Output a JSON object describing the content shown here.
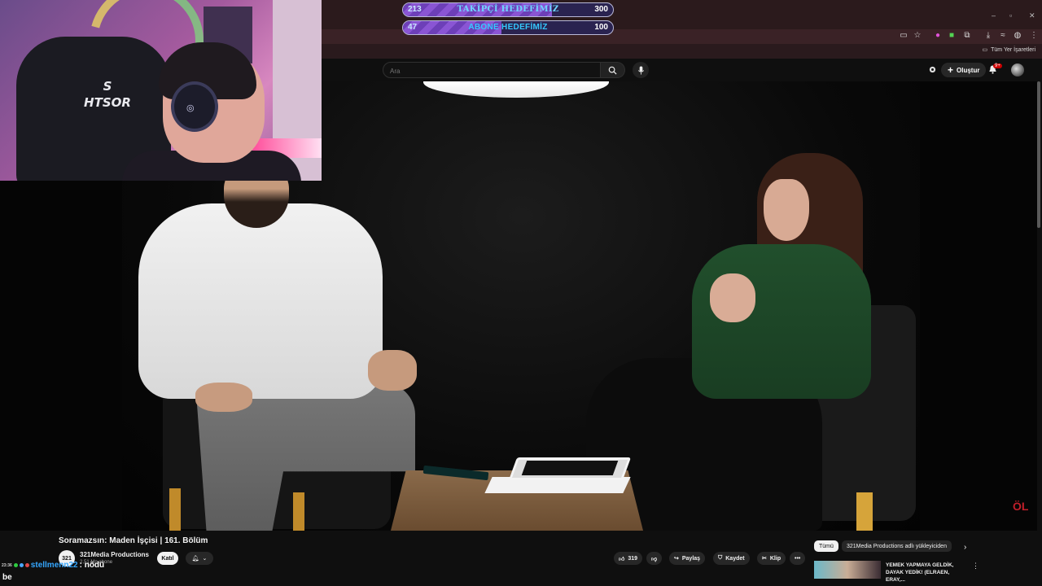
{
  "goals": {
    "followers": {
      "current": "213",
      "label": "TAKİPÇİ HEDEFİMİZ",
      "target": "300",
      "progress": 0.71
    },
    "subscribers": {
      "current": "47",
      "label": "ABONE HEDEFİMİZ",
      "target": "100",
      "progress": 0.47
    }
  },
  "browser": {
    "bookmarks_all": "Tüm Yer İşaretleri"
  },
  "youtube": {
    "search_placeholder": "Ara",
    "create_label": "Oluştur",
    "notification_count": "9+"
  },
  "webcam": {
    "chair_logo": "S\nHTSOR"
  },
  "video": {
    "title": "Soramazsın: Maden İşçisi | 161. Bölüm",
    "channel_avatar": "321",
    "channel_name": "321Media Productions",
    "channel_subs": "2,51 Mn abone",
    "join_label": "Katıl",
    "like_count": "319",
    "share_label": "Paylaş",
    "save_label": "Kaydet",
    "clip_label": "Klip",
    "more_label": "•••",
    "watermark": "ÖL"
  },
  "recommendations": {
    "chips": [
      "Tümü",
      "321Media Productions adlı yükleyiciden"
    ],
    "first": {
      "title": "YEMEK YAPMAYA GELDİK, DAYAK YEDİK! (ELRAEN, ERAY,..."
    }
  },
  "chat": {
    "time": "23:36",
    "username": "stellmenn22",
    "message": ": nödü",
    "next_line": "be"
  },
  "colors": {
    "goal_label": "#35c8ff",
    "chat_user": "#35a7ff",
    "yt_red": "#cc0000"
  }
}
